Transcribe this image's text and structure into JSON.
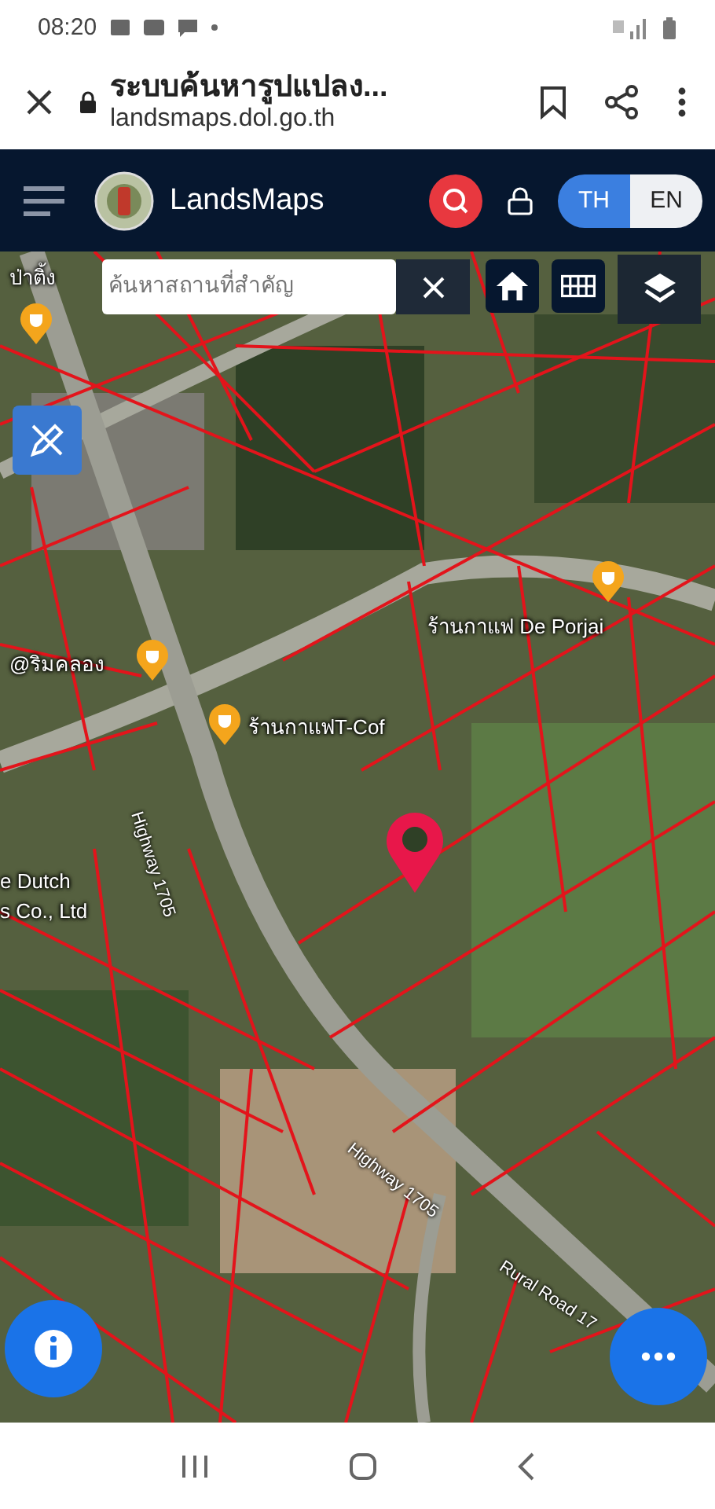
{
  "status_bar": {
    "time": "08:20"
  },
  "browser": {
    "title": "ระบบค้นหารูปแปลง...",
    "url": "landsmaps.dol.go.th"
  },
  "header": {
    "app_name": "LandsMaps",
    "languages": [
      {
        "label": "TH",
        "selected": true
      },
      {
        "label": "EN",
        "selected": false
      }
    ]
  },
  "map": {
    "search": {
      "placeholder": "ค้นหาสถานที่สำคัญ"
    },
    "labels": [
      {
        "text": "ป่าติ้ง",
        "kind": "place"
      },
      {
        "text": "ร้านกาแฟ De Porjai",
        "kind": "place"
      },
      {
        "text": "@ริมคลอง",
        "kind": "place"
      },
      {
        "text": "ร้านกาแฟT-Cof",
        "kind": "place"
      },
      {
        "text": "Highway 1705",
        "kind": "road"
      },
      {
        "text": "e Dutch",
        "kind": "place"
      },
      {
        "text": "s Co., Ltd",
        "kind": "place"
      },
      {
        "text": "Highway 1705",
        "kind": "road"
      },
      {
        "text": "Rural Road 17",
        "kind": "road"
      }
    ]
  }
}
